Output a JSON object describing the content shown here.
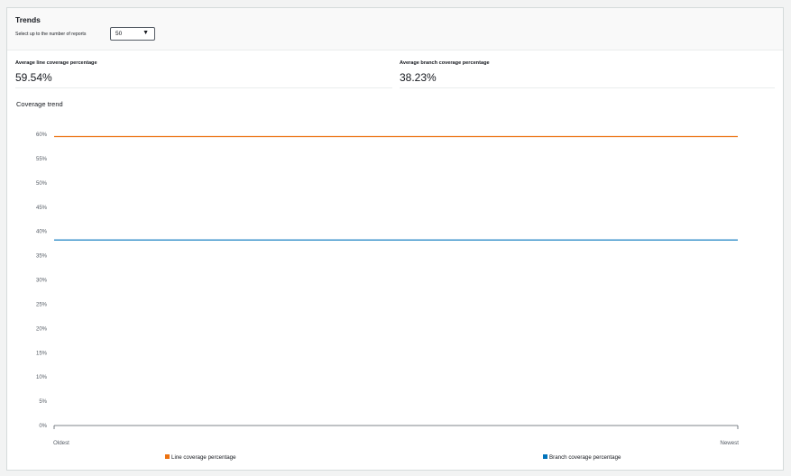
{
  "panel": {
    "title": "Trends",
    "select_label": "Select up to the number of reports",
    "select_value": "50"
  },
  "metrics": {
    "line": {
      "label": "Average line coverage percentage",
      "value": "59.54%"
    },
    "branch": {
      "label": "Average branch coverage percentage",
      "value": "38.23%"
    }
  },
  "icons": {
    "select_caret": "caret-down-icon"
  },
  "chart_data": {
    "type": "line",
    "title": "Coverage trend",
    "x_tick_labels": [
      "Oldest",
      "Newest"
    ],
    "y_ticks": [
      0,
      5,
      10,
      15,
      20,
      25,
      30,
      35,
      40,
      45,
      50,
      55,
      60
    ],
    "y_tick_labels": [
      "0%",
      "5%",
      "10%",
      "15%",
      "20%",
      "25%",
      "30%",
      "35%",
      "40%",
      "45%",
      "50%",
      "55%",
      "60%"
    ],
    "ylim": [
      0,
      60
    ],
    "grid": false,
    "legend_placement": "bottom",
    "series": [
      {
        "name": "Line coverage percentage",
        "color": "#ec7211",
        "values": [
          59.54,
          59.54
        ]
      },
      {
        "name": "Branch coverage percentage",
        "color": "#0073bb",
        "values": [
          38.23,
          38.23
        ]
      }
    ]
  }
}
